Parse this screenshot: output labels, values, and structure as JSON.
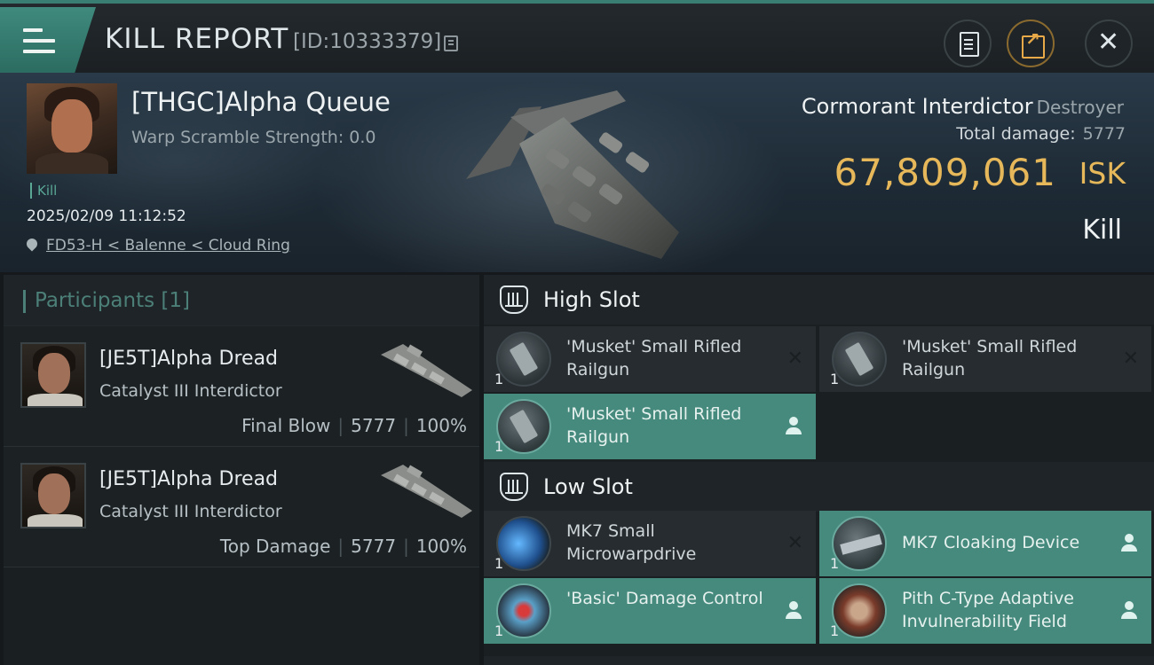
{
  "header": {
    "title": "KILL REPORT",
    "report_id": "[ID:10333379]"
  },
  "victim": {
    "name": "[THGC]Alpha Queue",
    "warp_scramble": "Warp Scramble Strength: 0.0",
    "tag": "Kill",
    "time": "2025/02/09 11:12:52",
    "location": "FD53-H < Balenne < Cloud Ring",
    "ship_name": "Cormorant Interdictor",
    "ship_class": "Destroyer",
    "total_damage_label": "Total damage:",
    "total_damage_value": "5777",
    "isk_value": "67,809,061",
    "isk_label": "ISK",
    "result": "Kill"
  },
  "participants": {
    "title": "Participants [1]",
    "rows": [
      {
        "name": "[JE5T]Alpha Dread",
        "ship": "Catalyst III Interdictor",
        "role": "Final Blow",
        "damage": "5777",
        "percent": "100%"
      },
      {
        "name": "[JE5T]Alpha Dread",
        "ship": "Catalyst III Interdictor",
        "role": "Top Damage",
        "damage": "5777",
        "percent": "100%"
      }
    ]
  },
  "fitting": {
    "high_slot": {
      "label": "High Slot",
      "items": [
        {
          "name": "'Musket' Small Rifled Railgun",
          "qty": "1",
          "status": "destroyed",
          "status_glyph": "✕"
        },
        {
          "name": "'Musket' Small Rifled Railgun",
          "qty": "1",
          "status": "destroyed",
          "status_glyph": "✕"
        },
        {
          "name": "'Musket' Small Rifled Railgun",
          "qty": "1",
          "status": "dropped"
        }
      ]
    },
    "low_slot": {
      "label": "Low Slot",
      "items": [
        {
          "name": "MK7 Small Microwarpdrive",
          "qty": "1",
          "status": "destroyed",
          "status_glyph": "✕"
        },
        {
          "name": "MK7 Cloaking Device",
          "qty": "1",
          "status": "dropped"
        },
        {
          "name": "'Basic' Damage Control",
          "qty": "1",
          "status": "dropped"
        },
        {
          "name": "Pith C-Type Adaptive Invulnerability Field",
          "qty": "1",
          "status": "dropped"
        }
      ]
    }
  },
  "colors": {
    "accent": "#3f8a7d",
    "dropped_item": "#468a7e",
    "isk_gold": "#e7b85a"
  },
  "icons": {
    "menu": "menu-icon",
    "copy": "copy-icon",
    "notes": "clipboard-icon",
    "share": "share-icon",
    "close": "close-icon",
    "location": "map-pin-icon",
    "slot": "slot-icon",
    "dropped": "person-icon",
    "destroyed": "x-icon"
  }
}
